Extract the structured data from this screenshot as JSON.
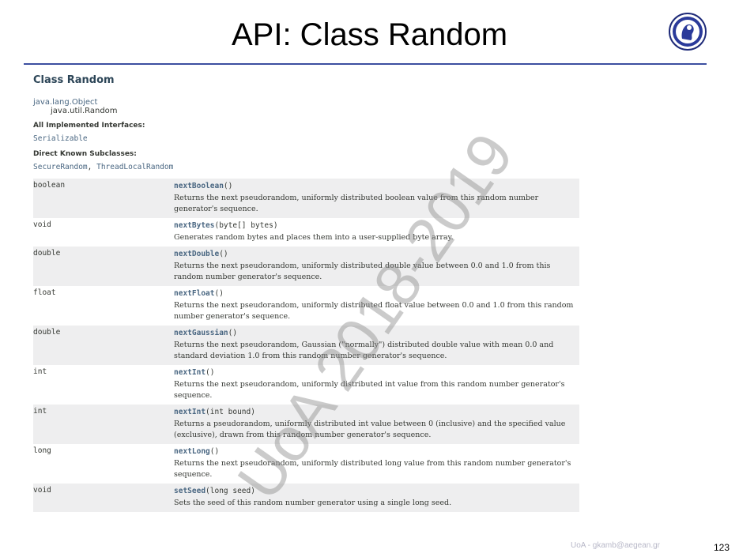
{
  "slide": {
    "title": "API: Class Random",
    "footer": "UoA - gkamb@aegean.gr",
    "page_number": "123",
    "watermark": "UoA 2018-2019"
  },
  "doc": {
    "class_title": "Class Random",
    "hierarchy": [
      "java.lang.Object",
      "java.util.Random"
    ],
    "interfaces_label": "All Implemented Interfaces:",
    "interfaces": [
      "Serializable"
    ],
    "subclasses_label": "Direct Known Subclasses:",
    "subclasses": [
      "SecureRandom",
      "ThreadLocalRandom"
    ],
    "subclass_separator": ", ",
    "methods": [
      {
        "type": "boolean",
        "name": "nextBoolean",
        "params": "()",
        "desc": "Returns the next pseudorandom, uniformly distributed boolean value from this random number generator's sequence."
      },
      {
        "type": "void",
        "name": "nextBytes",
        "params": "(byte[] bytes)",
        "desc": "Generates random bytes and places them into a user-supplied byte array."
      },
      {
        "type": "double",
        "name": "nextDouble",
        "params": "()",
        "desc": "Returns the next pseudorandom, uniformly distributed double value between 0.0 and 1.0 from this random number generator's sequence."
      },
      {
        "type": "float",
        "name": "nextFloat",
        "params": "()",
        "desc": "Returns the next pseudorandom, uniformly distributed float value between 0.0 and 1.0 from this random number generator's sequence."
      },
      {
        "type": "double",
        "name": "nextGaussian",
        "params": "()",
        "desc": "Returns the next pseudorandom, Gaussian (\"normally\") distributed double value with mean 0.0 and standard deviation 1.0 from this random number generator's sequence."
      },
      {
        "type": "int",
        "name": "nextInt",
        "params": "()",
        "desc": "Returns the next pseudorandom, uniformly distributed int value from this random number generator's sequence."
      },
      {
        "type": "int",
        "name": "nextInt",
        "params": "(int bound)",
        "desc": "Returns a pseudorandom, uniformly distributed int value between 0 (inclusive) and the specified value (exclusive), drawn from this random number generator's sequence."
      },
      {
        "type": "long",
        "name": "nextLong",
        "params": "()",
        "desc": "Returns the next pseudorandom, uniformly distributed long value from this random number generator's sequence."
      },
      {
        "type": "void",
        "name": "setSeed",
        "params": "(long seed)",
        "desc": "Sets the seed of this random number generator using a single long seed."
      }
    ]
  }
}
